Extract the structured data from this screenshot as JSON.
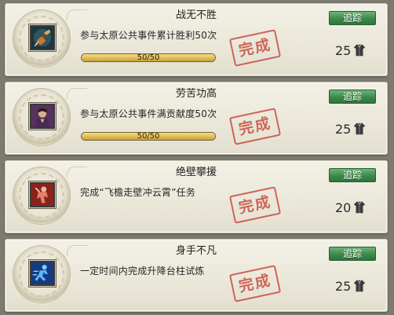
{
  "achievements": [
    {
      "title": "战无不胜",
      "description": "参与太原公共事件累计胜利50次",
      "progress_text": "50/50",
      "progress": 1.0,
      "stamp_text": "完成",
      "track_label": "追踪",
      "reward_points": "25",
      "icon": "fist-weapon-icon"
    },
    {
      "title": "劳苦功高",
      "description": "参与太原公共事件满贡献度50次",
      "progress_text": "50/50",
      "progress": 1.0,
      "stamp_text": "完成",
      "track_label": "追踪",
      "reward_points": "25",
      "icon": "hero-portrait-icon"
    },
    {
      "title": "绝壁攀援",
      "description": "完成“飞檐走壁冲云霄”任务",
      "stamp_text": "完成",
      "track_label": "追踪",
      "reward_points": "20",
      "icon": "climbing-figure-icon"
    },
    {
      "title": "身手不凡",
      "description": "一定时间内完成升降台柱试炼",
      "stamp_text": "完成",
      "track_label": "追踪",
      "reward_points": "25",
      "icon": "running-figure-icon"
    }
  ],
  "colors": {
    "panel": "#ebe8da",
    "track_button": "#3c8a4a",
    "stamp": "#c43a2e",
    "progress_fill": "#e6c35a"
  },
  "reward_icon": "armor-robe-icon"
}
